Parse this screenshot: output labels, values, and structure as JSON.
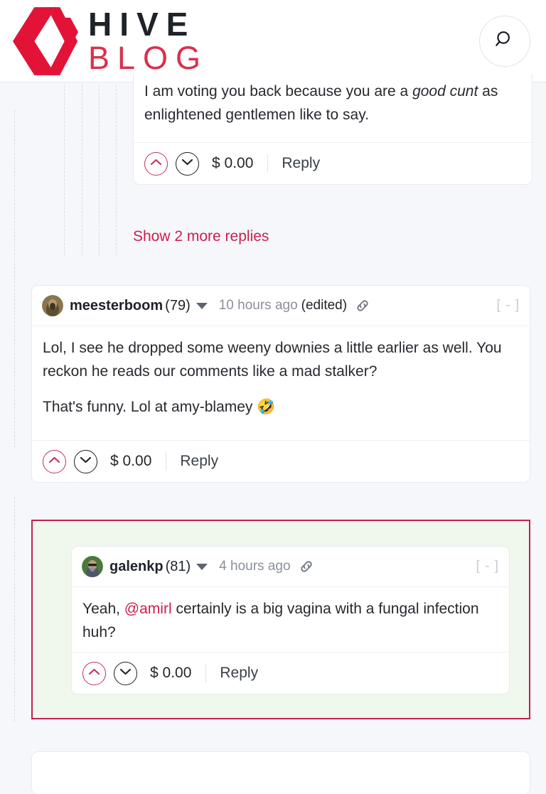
{
  "site": {
    "brand_line1": "HIVE",
    "brand_line2": "BLOG",
    "logo_icon": "hive-logo-icon",
    "search_icon": "search-icon",
    "brand_red": "#d9304b",
    "page_background": "#f6f7fb"
  },
  "comments": [
    {
      "id": "comment-partial-top",
      "body_html": "I am voting you back because you are a <em>good cunt</em> as enlightened gentlemen like to say.",
      "footer": {
        "upvote_icon": "chevron-up-icon",
        "downvote_icon": "chevron-down-icon",
        "payout": "$ 0.00",
        "reply_label": "Reply"
      }
    },
    {
      "id": "comment-meesterboom",
      "author": "meesterboom",
      "reputation": "(79)",
      "timestamp": "10 hours ago",
      "edited_label": "(edited)",
      "link_icon": "link-icon",
      "collapse_label": "[ - ]",
      "caret_icon": "chevron-down-icon",
      "avatar_icon": "avatar",
      "paragraphs": [
        "Lol, I see he dropped some weeny downies a little earlier as well. You reckon he reads our comments like a mad stalker?",
        "That's funny. Lol at amy-blamey 🤣"
      ],
      "footer": {
        "upvote_icon": "chevron-up-icon",
        "downvote_icon": "chevron-down-icon",
        "payout": "$ 0.00",
        "reply_label": "Reply"
      }
    },
    {
      "id": "comment-galenkp",
      "highlighted": true,
      "highlight_border": "#c2224c",
      "highlight_background": "#f0f7ec",
      "author": "galenkp",
      "reputation": "(81)",
      "timestamp": "4 hours ago",
      "link_icon": "link-icon",
      "collapse_label": "[ - ]",
      "caret_icon": "chevron-down-icon",
      "avatar_icon": "avatar",
      "body_prefix": "Yeah, ",
      "mention": "@amirl",
      "body_suffix": " certainly is a big vagina with a fungal infection huh?",
      "footer": {
        "upvote_icon": "chevron-up-icon",
        "downvote_icon": "chevron-down-icon",
        "payout": "$ 0.00",
        "reply_label": "Reply"
      }
    }
  ],
  "show_more": {
    "label": "Show 2 more replies"
  }
}
